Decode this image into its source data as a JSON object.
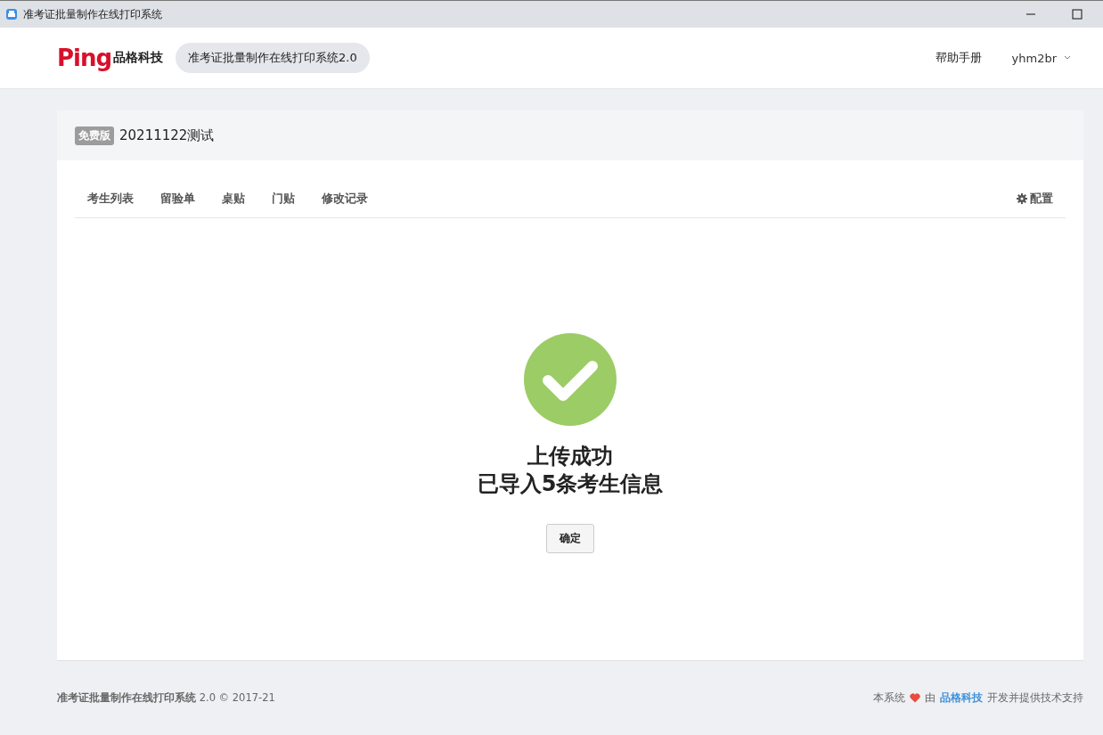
{
  "window": {
    "title": "准考证批量制作在线打印系统"
  },
  "header": {
    "logo_mark": "Ping",
    "logo_text": "品格科技",
    "app_badge": "准考证批量制作在线打印系统2.0",
    "help": "帮助手册",
    "user": "yhm2br"
  },
  "project": {
    "edition": "免费版",
    "name": "20211122测试"
  },
  "tabs": [
    {
      "label": "考生列表"
    },
    {
      "label": "留验单"
    },
    {
      "label": "桌贴"
    },
    {
      "label": "门贴"
    },
    {
      "label": "修改记录"
    }
  ],
  "settings": "配置",
  "result": {
    "title": "上传成功",
    "message": "已导入5条考生信息",
    "button": "确定"
  },
  "footer": {
    "left": "**准考证批量制作在线打印系统** 2.0 © 2017-21",
    "right_before": "本系统",
    "right_by": "由",
    "right_link": "品格科技",
    "right_after": "开发并提供技术支持"
  }
}
